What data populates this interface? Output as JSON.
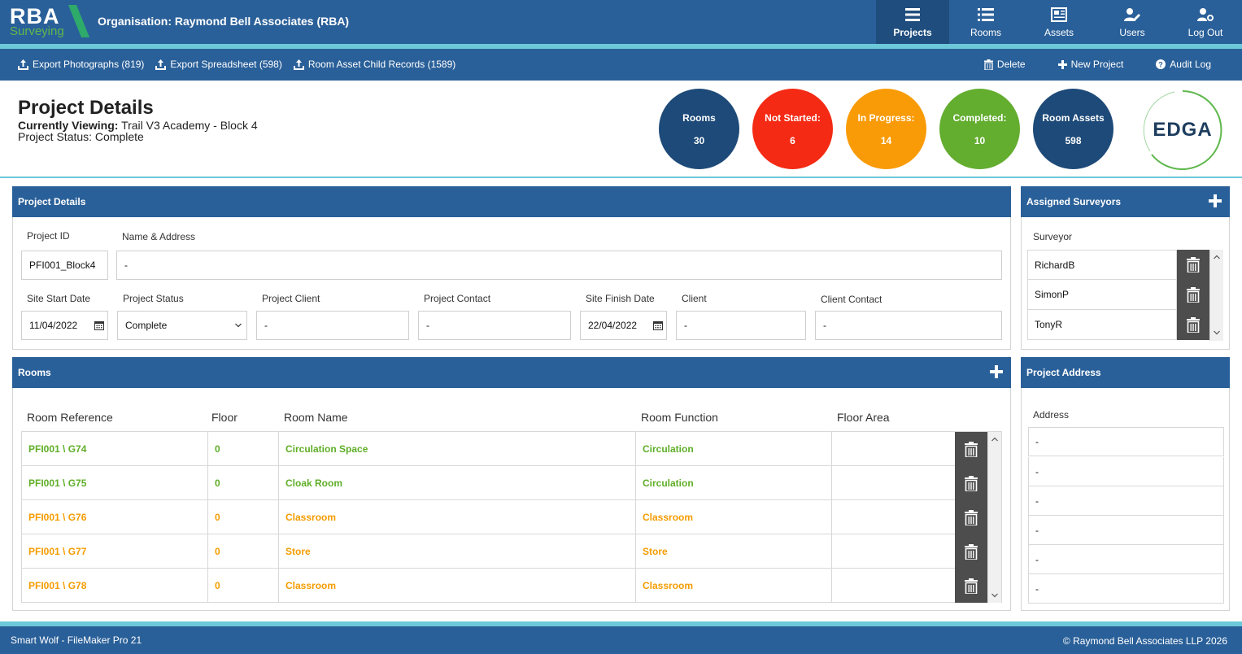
{
  "header": {
    "logo_main": "RBA",
    "logo_sub": "Surveying",
    "organisation": "Organisation: Raymond Bell Associates (RBA)",
    "nav": [
      {
        "label": "Projects",
        "icon": "list-icon",
        "active": true
      },
      {
        "label": "Rooms",
        "icon": "bulleted-list-icon",
        "active": false
      },
      {
        "label": "Assets",
        "icon": "newspaper-icon",
        "active": false
      },
      {
        "label": "Users",
        "icon": "user-edit-icon",
        "active": false
      },
      {
        "label": "Log Out",
        "icon": "user-settings-icon",
        "active": false
      }
    ]
  },
  "toolbar": {
    "export_photos": "Export Photographs (819)",
    "export_spreadsheet": "Export Spreadsheet (598)",
    "room_asset_child": "Room Asset Child Records (1589)",
    "delete": "Delete",
    "new_project": "New Project",
    "audit_log": "Audit Log"
  },
  "project": {
    "title": "Project Details",
    "viewing_label": "Currently Viewing:",
    "viewing_value": "Trail V3 Academy - Block 4",
    "status_line": "Project Status: Complete"
  },
  "stats": [
    {
      "label": "Rooms",
      "value": "30",
      "color": "#1d4a78"
    },
    {
      "label": "Not Started:",
      "value": "6",
      "color": "#f42a14"
    },
    {
      "label": "In Progress:",
      "value": "14",
      "color": "#f99b07"
    },
    {
      "label": "Completed:",
      "value": "10",
      "color": "#63ad2f"
    },
    {
      "label": "Room Assets",
      "value": "598",
      "color": "#1d4a78"
    }
  ],
  "client_logo": "EDGA",
  "details_panel": {
    "title": "Project Details",
    "project_id_label": "Project ID",
    "project_id": "PFI001_Block4",
    "name_address_label": "Name & Address",
    "name_address": "-",
    "site_start_label": "Site Start Date",
    "site_start": "11/04/2022",
    "project_status_label": "Project Status",
    "project_status": "Complete",
    "project_client_label": "Project Client",
    "project_client": "-",
    "project_contact_label": "Project Contact",
    "project_contact": "-",
    "site_finish_label": "Site Finish Date",
    "site_finish": "22/04/2022",
    "client_label": "Client",
    "client": "-",
    "client_contact_label": "Client Contact",
    "client_contact": "-"
  },
  "surveyors_panel": {
    "title": "Assigned Surveyors",
    "column": "Surveyor",
    "items": [
      "RichardB",
      "SimonP",
      "TonyR"
    ]
  },
  "rooms_panel": {
    "title": "Rooms",
    "columns": [
      "Room Reference",
      "Floor",
      "Room Name",
      "Room Function",
      "Floor Area"
    ],
    "rows": [
      {
        "ref": "PFI001 \\ G74",
        "floor": "0",
        "name": "Circulation Space",
        "function": "Circulation",
        "area": "",
        "status_color": "#5fae27"
      },
      {
        "ref": "PFI001 \\ G75",
        "floor": "0",
        "name": "Cloak Room",
        "function": "Circulation",
        "area": "",
        "status_color": "#5fae27"
      },
      {
        "ref": "PFI001 \\ G76",
        "floor": "0",
        "name": "Classroom",
        "function": "Classroom",
        "area": "",
        "status_color": "#f59c00"
      },
      {
        "ref": "PFI001 \\ G77",
        "floor": "0",
        "name": "Store",
        "function": "Store",
        "area": "",
        "status_color": "#f59c00"
      },
      {
        "ref": "PFI001 \\ G78",
        "floor": "0",
        "name": "Classroom",
        "function": "Classroom",
        "area": "",
        "status_color": "#f59c00"
      }
    ]
  },
  "address_panel": {
    "title": "Project Address",
    "column": "Address",
    "lines": [
      "-",
      "-",
      "-",
      "-",
      "-",
      "-"
    ]
  },
  "footer": {
    "left": "Smart Wolf - FileMaker Pro 21",
    "right": "© Raymond Bell Associates LLP 2026"
  },
  "colors": {
    "primary": "#2a6099",
    "accent": "#6dc9d9",
    "dark_button": "#4d4d4d"
  }
}
